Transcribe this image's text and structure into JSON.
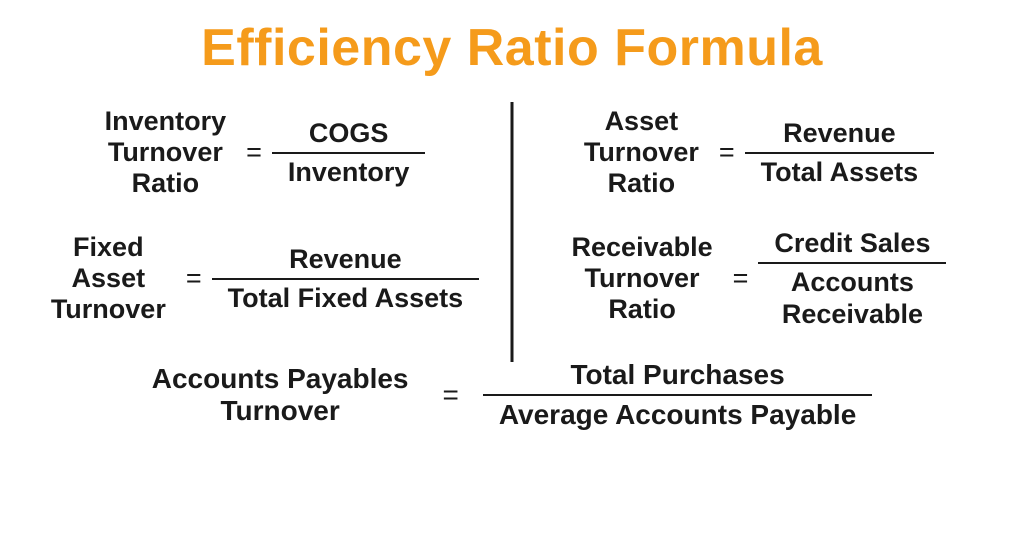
{
  "title": "Efficiency Ratio Formula",
  "formulas": {
    "f1": {
      "name_line1": "Inventory",
      "name_line2": "Turnover",
      "name_line3": "Ratio",
      "numerator": "COGS",
      "denominator": "Inventory"
    },
    "f2": {
      "name_line1": "Asset",
      "name_line2": "Turnover",
      "name_line3": "Ratio",
      "numerator": "Revenue",
      "denominator": "Total Assets"
    },
    "f3": {
      "name_line1": "Fixed",
      "name_line2": "Asset",
      "name_line3": "Turnover",
      "numerator": "Revenue",
      "denominator": "Total Fixed Assets"
    },
    "f4": {
      "name_line1": "Receivable",
      "name_line2": "Turnover",
      "name_line3": "Ratio",
      "numerator": "Credit Sales",
      "denom_line1": "Accounts",
      "denom_line2": "Receivable"
    },
    "f5": {
      "name_line1": "Accounts Payables",
      "name_line2": "Turnover",
      "numerator": "Total Purchases",
      "denominator": "Average Accounts Payable"
    }
  },
  "equals": "="
}
